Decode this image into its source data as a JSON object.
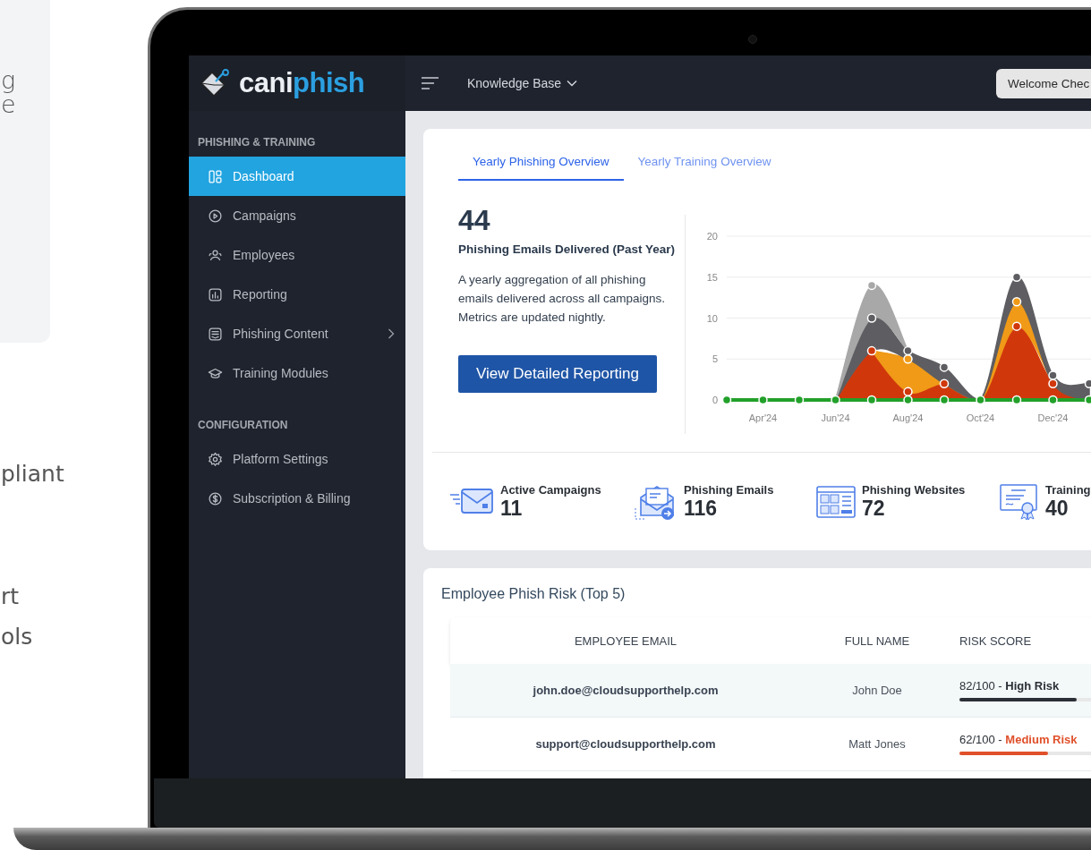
{
  "backdrop": {
    "fragments_top": [
      "g",
      "e"
    ],
    "fragments_bottom": [
      "pliant",
      "rt",
      "ols"
    ]
  },
  "logo": {
    "text": "cani",
    "accent_text": "phish"
  },
  "topbar": {
    "menu_label": "Knowledge Base",
    "welcome_button": "Welcome Chec"
  },
  "sidebar": {
    "sections": [
      {
        "title": "PHISHING & TRAINING",
        "items": [
          {
            "label": "Dashboard",
            "kind": "dashboard",
            "selected": true,
            "has_submenu": false
          },
          {
            "label": "Campaigns",
            "kind": "play",
            "selected": false,
            "has_submenu": false
          },
          {
            "label": "Employees",
            "kind": "users",
            "selected": false,
            "has_submenu": false
          },
          {
            "label": "Reporting",
            "kind": "report",
            "selected": false,
            "has_submenu": false
          },
          {
            "label": "Phishing Content",
            "kind": "content",
            "selected": false,
            "has_submenu": true
          },
          {
            "label": "Training Modules",
            "kind": "cap",
            "selected": false,
            "has_submenu": false
          }
        ]
      },
      {
        "title": "CONFIGURATION",
        "items": [
          {
            "label": "Platform Settings",
            "kind": "gear",
            "selected": false,
            "has_submenu": false
          },
          {
            "label": "Subscription & Billing",
            "kind": "dollar",
            "selected": false,
            "has_submenu": false
          }
        ]
      }
    ]
  },
  "overview": {
    "tabs": [
      {
        "label": "Yearly Phishing Overview",
        "selected": true
      },
      {
        "label": "Yearly Training Overview",
        "selected": false
      }
    ],
    "count": "44",
    "count_label": "Phishing Emails Delivered (Past Year)",
    "description": "A yearly aggregation of all phishing emails delivered across all campaigns. Metrics are updated nightly.",
    "button": "View Detailed Reporting",
    "chart_data": {
      "type": "area",
      "stacked": true,
      "categories": [
        null,
        "Apr'24",
        null,
        "Jun'24",
        null,
        "Aug'24",
        null,
        "Oct'24",
        null,
        "Dec'24",
        null
      ],
      "ylim": [
        0,
        20
      ],
      "yticks": [
        0,
        5,
        10,
        15,
        20
      ],
      "grid": true,
      "series": [
        {
          "type": "line",
          "marker": "circle",
          "color": "#22a02a",
          "values": [
            0,
            0,
            0,
            0,
            0,
            0,
            0,
            0,
            0,
            0,
            0
          ]
        },
        {
          "marker": "circle",
          "color": "#d0380c",
          "values": [
            null,
            null,
            null,
            0,
            6,
            1,
            2,
            0,
            9,
            2,
            0
          ]
        },
        {
          "color": "#f09a18",
          "values": [
            null,
            null,
            null,
            null,
            0,
            4,
            0,
            0,
            3,
            0,
            null
          ]
        },
        {
          "marker": "circle",
          "color": "#5e5e62",
          "values": [
            null,
            null,
            null,
            0,
            4,
            1,
            2,
            0,
            3,
            1,
            2
          ]
        },
        {
          "color": "#a8a8a8",
          "values": [
            null,
            null,
            null,
            0,
            4,
            0,
            null,
            null,
            null,
            null,
            null
          ]
        }
      ]
    }
  },
  "stats": [
    {
      "label": "Active Campaigns",
      "value": "11",
      "kind": "campaigns"
    },
    {
      "label": "Phishing Emails",
      "value": "116",
      "kind": "emails"
    },
    {
      "label": "Phishing Websites",
      "value": "72",
      "kind": "websites"
    },
    {
      "label": "Training",
      "value": "40",
      "kind": "training"
    }
  ],
  "risk_table": {
    "title": "Employee Phish Risk (Top 5)",
    "columns": [
      "EMPLOYEE EMAIL",
      "FULL NAME",
      "RISK SCORE"
    ],
    "rows": [
      {
        "email": "john.doe@cloudsupporthelp.com",
        "name": "John Doe",
        "risk": "82/100 - **High Risk**",
        "kind": "high",
        "level": 0.82,
        "highlighted": true
      },
      {
        "email": "support@cloudsupporthelp.com",
        "name": "Matt Jones",
        "risk": "62/100 - **Medium Risk**",
        "kind": "medium",
        "level": 0.62,
        "highlighted": false
      }
    ]
  }
}
